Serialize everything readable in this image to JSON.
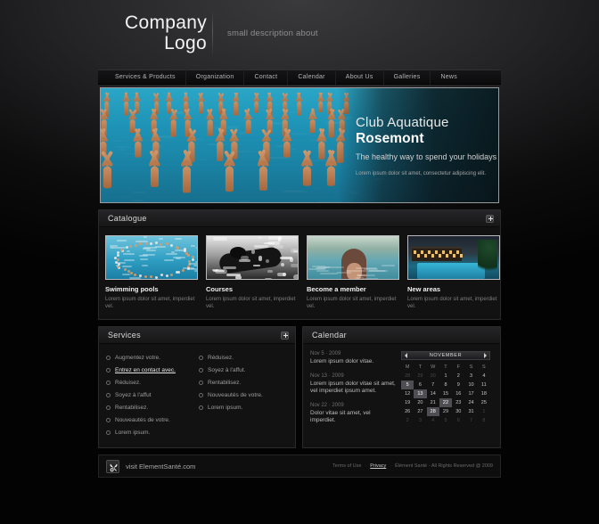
{
  "header": {
    "logo_line1": "Company",
    "logo_line2": "Logo",
    "description": "small description about"
  },
  "nav": {
    "items": [
      {
        "label": "Services & Products"
      },
      {
        "label": "Organization"
      },
      {
        "label": "Contact"
      },
      {
        "label": "Calendar"
      },
      {
        "label": "About Us"
      },
      {
        "label": "Galleries"
      },
      {
        "label": "News"
      }
    ]
  },
  "hero": {
    "title_light": "Club Aquatique",
    "title_bold": "Rosemont",
    "tagline": "The healthy way to spend your holidays",
    "lorem": "Lorem ipsum dolor sit amet, consectetur adipiscing elit.",
    "image_alt": "water-aerobics-class-in-pool"
  },
  "catalogue": {
    "title": "Catalogue",
    "expand_icon": "plus-icon",
    "items": [
      {
        "name": "Swimming pools",
        "desc": "Lorem ipsum dolor sit amet, imperdiet vel.",
        "image_alt": "aerial-view-of-crowded-pool"
      },
      {
        "name": "Courses",
        "desc": "Lorem ipsum dolor sit amet, imperdiet vel.",
        "image_alt": "black-and-white-swimmer"
      },
      {
        "name": "Become a member",
        "desc": "Lorem ipsum dolor sit amet, imperdiet vel.",
        "image_alt": "woman-standing-in-pool"
      },
      {
        "name": "New areas",
        "desc": "Lorem ipsum dolor sit amet, imperdiet vel.",
        "image_alt": "resort-pool-at-dusk"
      }
    ]
  },
  "services": {
    "title": "Services",
    "expand_icon": "plus-icon",
    "col1": [
      {
        "label": "Augmentez votre.",
        "active": false
      },
      {
        "label": "Entrez en contact avec.",
        "active": true
      },
      {
        "label": "Réduisez.",
        "active": false
      },
      {
        "label": "Soyez à l'affut",
        "active": false
      },
      {
        "label": "Rentabilisez.",
        "active": false
      },
      {
        "label": "Nouveautés de votre.",
        "active": false
      },
      {
        "label": "Lorem ipsum.",
        "active": false
      }
    ],
    "col2": [
      {
        "label": "Réduisez.",
        "active": false
      },
      {
        "label": "Soyez à l'affut.",
        "active": false
      },
      {
        "label": "Rentabilisez.",
        "active": false
      },
      {
        "label": "Nouveautés de votre.",
        "active": false
      },
      {
        "label": "Lorem ipsum.",
        "active": false
      }
    ]
  },
  "calendar": {
    "title": "Calendar",
    "news": [
      {
        "date": "Nov 5 · 2009",
        "text": "Lorem ipsum dolor vitae."
      },
      {
        "date": "Nov 13 · 2009",
        "text": "Lorem ipsum dolor vitae sit amet, vel imperdiet ipsum amet."
      },
      {
        "date": "Nov 22 · 2009",
        "text": "Dolor vitae sit amet, vel imperdiet."
      }
    ],
    "month": "NOVEMBER",
    "prev_icon": "chevron-left-icon",
    "next_icon": "chevron-right-icon",
    "weekdays": [
      "M",
      "T",
      "W",
      "T",
      "F",
      "S",
      "S"
    ],
    "weeks": [
      [
        {
          "d": "28",
          "out": true
        },
        {
          "d": "29",
          "out": true
        },
        {
          "d": "30",
          "out": true
        },
        {
          "d": "1"
        },
        {
          "d": "2"
        },
        {
          "d": "3"
        },
        {
          "d": "4"
        }
      ],
      [
        {
          "d": "5",
          "hl": true
        },
        {
          "d": "6"
        },
        {
          "d": "7"
        },
        {
          "d": "8"
        },
        {
          "d": "9"
        },
        {
          "d": "10"
        },
        {
          "d": "11"
        }
      ],
      [
        {
          "d": "12"
        },
        {
          "d": "13",
          "hl": true
        },
        {
          "d": "14"
        },
        {
          "d": "15"
        },
        {
          "d": "16"
        },
        {
          "d": "17"
        },
        {
          "d": "18"
        }
      ],
      [
        {
          "d": "19"
        },
        {
          "d": "20"
        },
        {
          "d": "21"
        },
        {
          "d": "22",
          "hl": true
        },
        {
          "d": "23"
        },
        {
          "d": "24"
        },
        {
          "d": "25"
        }
      ],
      [
        {
          "d": "26"
        },
        {
          "d": "27"
        },
        {
          "d": "28",
          "hl": true
        },
        {
          "d": "29"
        },
        {
          "d": "30"
        },
        {
          "d": "31"
        },
        {
          "d": "1",
          "out": true
        }
      ],
      [
        {
          "d": "2",
          "out": true
        },
        {
          "d": "3",
          "out": true
        },
        {
          "d": "4",
          "out": true
        },
        {
          "d": "5",
          "out": true
        },
        {
          "d": "6",
          "out": true
        },
        {
          "d": "7",
          "out": true
        },
        {
          "d": "8",
          "out": true
        }
      ]
    ]
  },
  "footer": {
    "logo_icon": "butterfly-leaf-icon",
    "site": "visit ElementSanté.com",
    "terms": "Terms of Use",
    "privacy": "Privacy",
    "copyright": "Élément Santé - All Rights Reserved @ 2009",
    "separator": "·"
  }
}
